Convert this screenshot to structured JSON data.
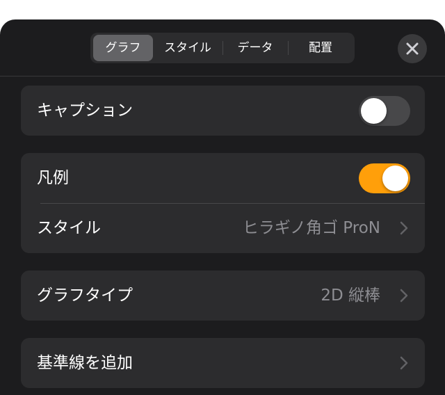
{
  "tabs": [
    {
      "label": "グラフ",
      "selected": true
    },
    {
      "label": "スタイル",
      "selected": false
    },
    {
      "label": "データ",
      "selected": false
    },
    {
      "label": "配置",
      "selected": false
    }
  ],
  "close_icon": "xmark-icon",
  "caption": {
    "label": "キャプション",
    "toggle_on": false
  },
  "legend": {
    "label": "凡例",
    "toggle_on": true
  },
  "style": {
    "label": "スタイル",
    "value": "ヒラギノ角ゴ ProN"
  },
  "chart_type": {
    "label": "グラフタイプ",
    "value": "2D 縦棒"
  },
  "reference_line": {
    "label": "基準線を追加"
  },
  "colors": {
    "sheet_background": "#1c1c1e",
    "group_background": "#2c2c2e",
    "toggle_on": "#ff9f0a",
    "toggle_off": "#48484a",
    "secondary_text": "#8e8e93"
  }
}
